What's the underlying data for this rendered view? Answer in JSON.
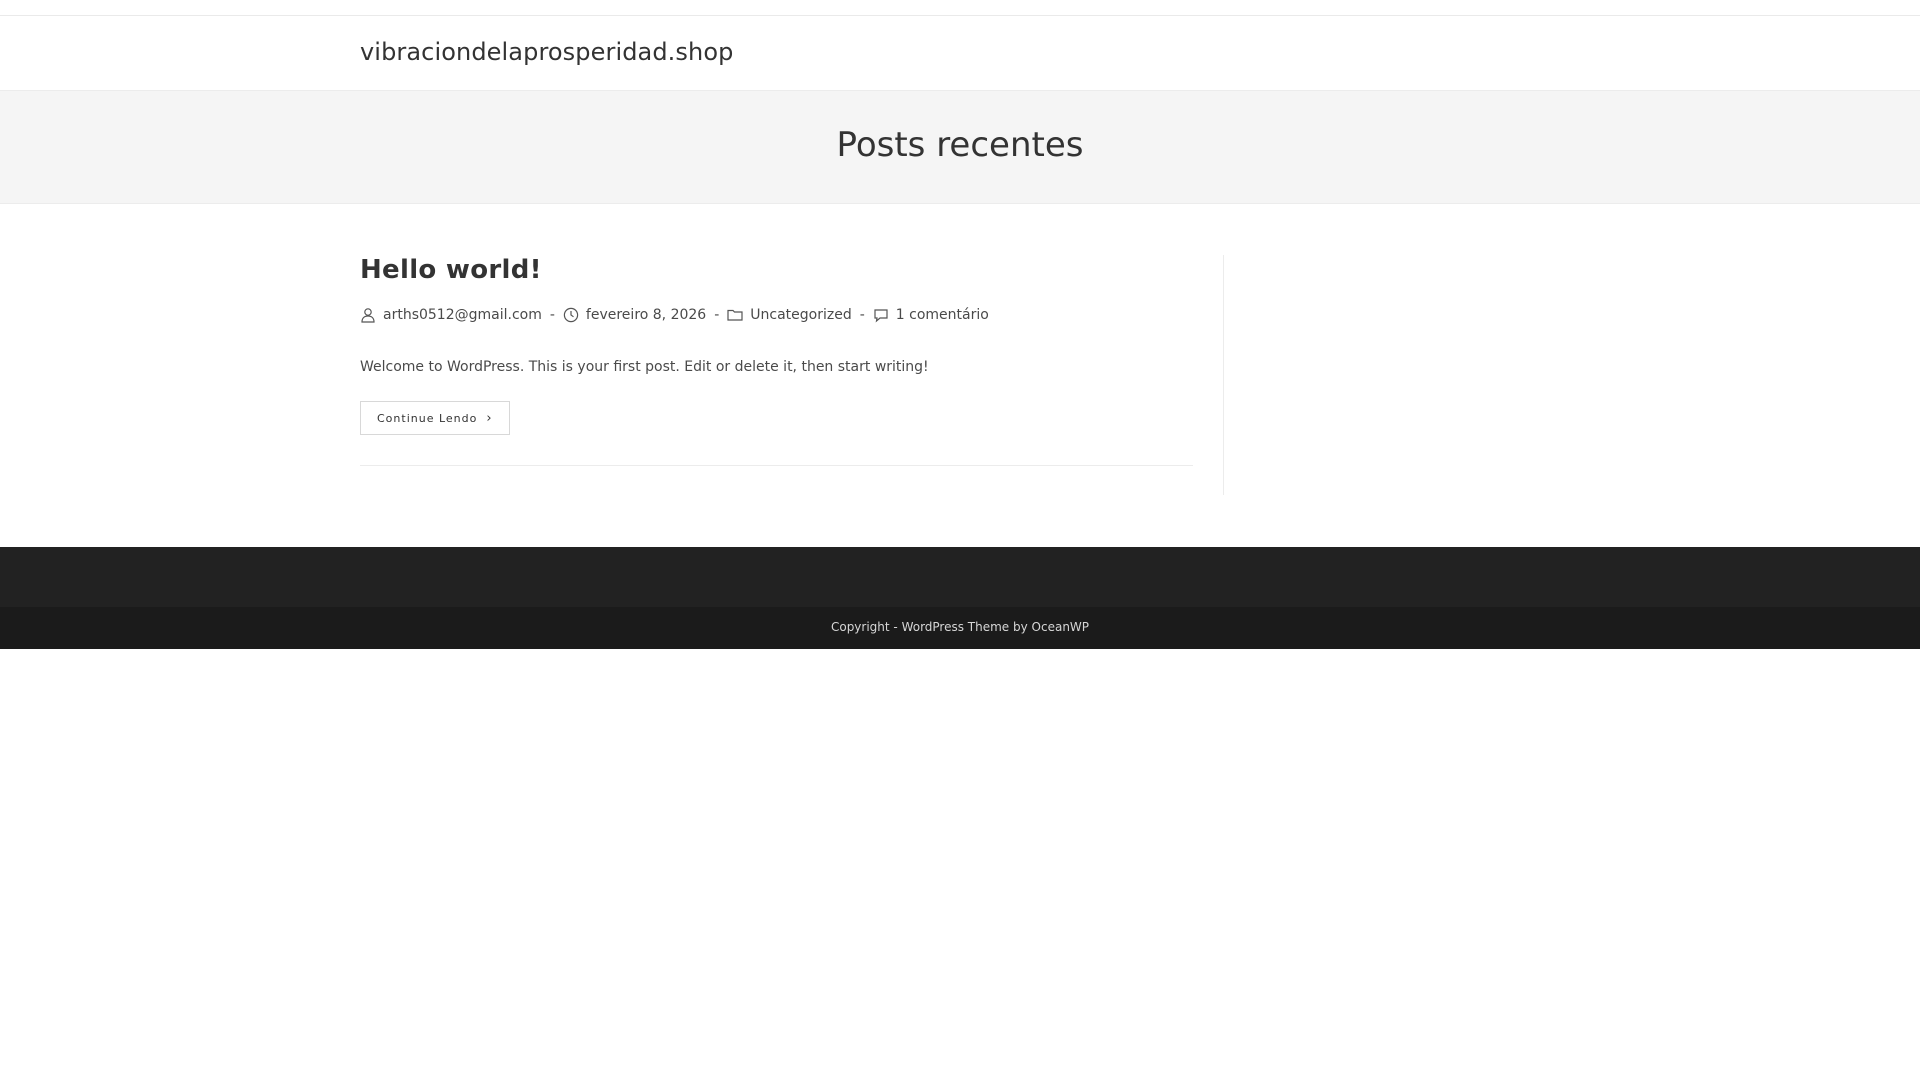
{
  "header": {
    "site_title": "vibraciondelaprosperidad.shop"
  },
  "page_header": {
    "title": "Posts recentes"
  },
  "post": {
    "title": "Hello world!",
    "meta": {
      "author": "arths0512@gmail.com",
      "date": "fevereiro 8, 2026",
      "category": "Uncategorized",
      "comments": "1 comentário",
      "separator": "-"
    },
    "excerpt": "Welcome to WordPress. This is your first post. Edit or delete it, then start writing!",
    "continue_label": "Continue Lendo",
    "continue_icon": "chevron-right-icon"
  },
  "footer": {
    "copyright_prefix": "Copyright - ",
    "copyright_link": "WordPress Theme by OceanWP"
  },
  "icons": {
    "author": "user-icon",
    "date": "clock-icon",
    "category": "folder-icon",
    "comments": "comment-icon"
  },
  "colors": {
    "page_header_bg": "#f5f5f5",
    "footer_widgets_bg": "#222222",
    "footer_bottom_bg": "#1b1b1b",
    "text": "#333333"
  }
}
